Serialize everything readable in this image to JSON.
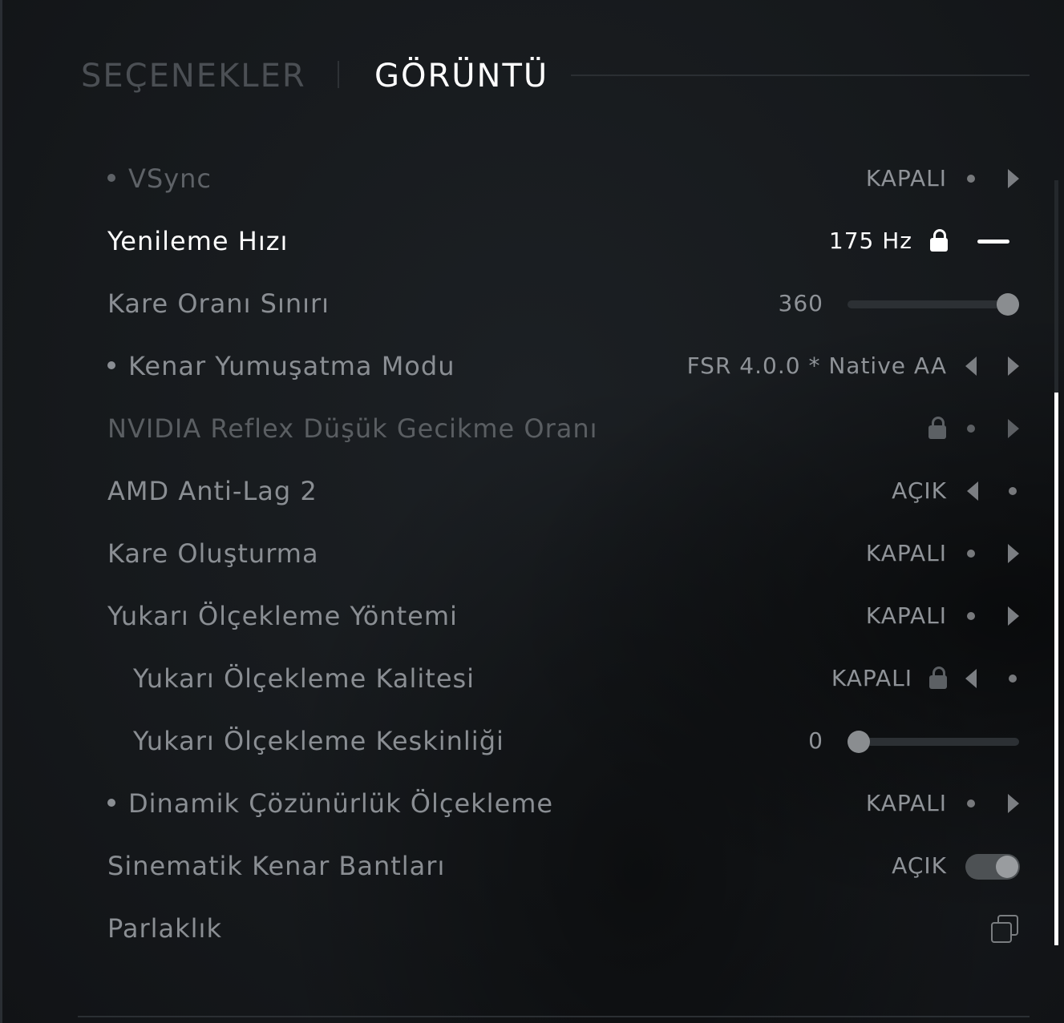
{
  "header": {
    "tabs": [
      {
        "label": "SEÇENEKLER",
        "active": false
      },
      {
        "label": "GÖRÜNTÜ",
        "active": true
      }
    ]
  },
  "settings": [
    {
      "label": "VSync",
      "value": "KAPALI",
      "control": "selector",
      "state": "dim"
    },
    {
      "label": "Yenileme Hızı",
      "value": "175 Hz",
      "control": "locked-minus",
      "state": "active"
    },
    {
      "label": "Kare Oranı Sınırı",
      "value": "360",
      "control": "slider",
      "slider_fraction": 1.0
    },
    {
      "label": "Kenar Yumuşatma Modu",
      "value": "FSR 4.0.0 * Native AA",
      "control": "selector"
    },
    {
      "label": "NVIDIA Reflex Düşük Gecikme Oranı",
      "value": "",
      "control": "locked-selector",
      "state": "dim"
    },
    {
      "label": "AMD Anti-Lag 2",
      "value": "AÇIK",
      "control": "selector"
    },
    {
      "label": "Kare Oluşturma",
      "value": "KAPALI",
      "control": "selector"
    },
    {
      "label": "Yukarı Ölçekleme Yöntemi",
      "value": "KAPALI",
      "control": "selector"
    },
    {
      "label": "Yukarı Ölçekleme Kalitesi",
      "value": "KAPALI",
      "control": "locked-selector",
      "indent": true
    },
    {
      "label": "Yukarı Ölçekleme Keskinliği",
      "value": "0",
      "control": "slider",
      "slider_fraction": 0.0,
      "indent": true
    },
    {
      "label": "Dinamik Çözünürlük Ölçekleme",
      "value": "KAPALI",
      "control": "selector"
    },
    {
      "label": "Sinematik Kenar Bantları",
      "value": "AÇIK",
      "control": "toggle",
      "toggle_on": true
    },
    {
      "label": "Parlaklık",
      "value": "",
      "control": "copy-icon"
    }
  ],
  "colors": {
    "background": "#15181b",
    "active_text": "#ffffff",
    "inactive_text": "#8a8e93",
    "scrollbar": "#ffffff"
  },
  "icons": [
    "arrow-left-icon",
    "arrow-right-icon",
    "dot-icon",
    "lock-icon",
    "minus-icon",
    "copy-icon"
  ]
}
